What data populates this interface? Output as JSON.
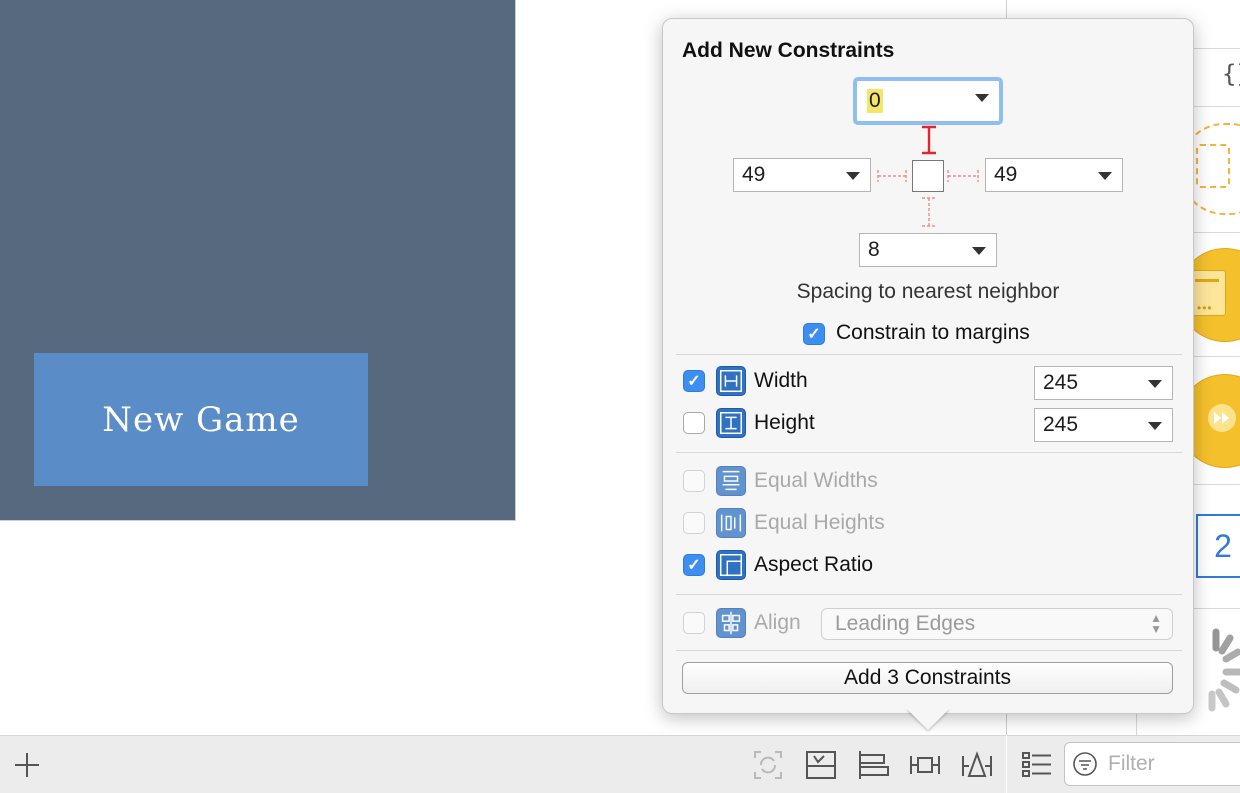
{
  "canvas": {
    "button_title": "New Game"
  },
  "popover": {
    "title": "Add New Constraints",
    "spacing": {
      "top": "0",
      "left": "49",
      "right": "49",
      "bottom": "8"
    },
    "spacing_caption": "Spacing to nearest neighbor",
    "constrain_to_margins": {
      "label": "Constrain to margins",
      "checked": true
    },
    "width": {
      "label": "Width",
      "checked": true,
      "value": "245"
    },
    "height": {
      "label": "Height",
      "checked": false,
      "value": "245"
    },
    "equal_widths": {
      "label": "Equal Widths",
      "enabled": false
    },
    "equal_heights": {
      "label": "Equal Heights",
      "enabled": false
    },
    "aspect_ratio": {
      "label": "Aspect Ratio",
      "checked": true
    },
    "align": {
      "label": "Align",
      "enabled": false,
      "selected": "Leading Edges"
    },
    "add_button_label": "Add 3 Constraints"
  },
  "library": {
    "code_snippet_glyph": "{}",
    "stepper_value": "2",
    "filter_placeholder": "Filter"
  },
  "icons": {
    "add": "plus-icon",
    "update_frames": "update-frames-icon",
    "embed_in_stack": "embed-stack-icon",
    "align": "align-icon",
    "pin": "pin-icon",
    "resolve": "resolve-issues-icon",
    "list_view": "list-view-icon",
    "filter": "filter-icon"
  },
  "colors": {
    "canvas_background": "#56697f",
    "button_background": "#5a8cc8",
    "accent": "#3d8ef0",
    "constraint_red": "#e0262f",
    "library_yellow": "#f4c02c"
  }
}
